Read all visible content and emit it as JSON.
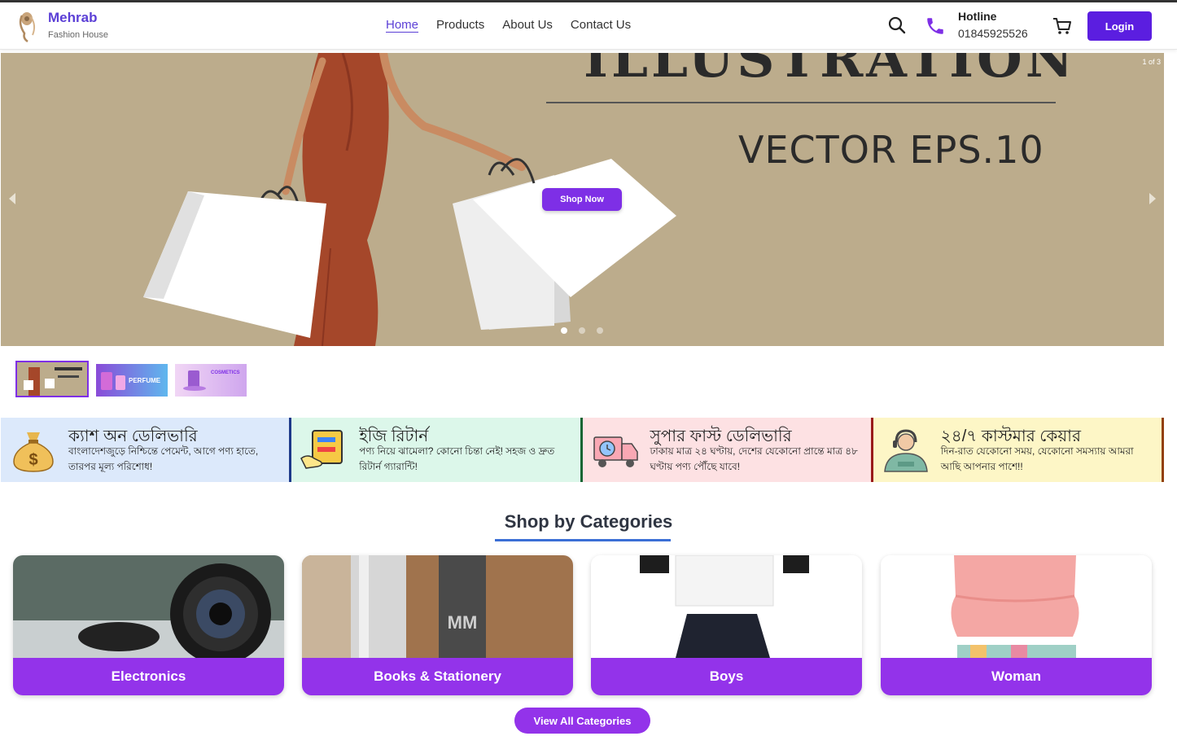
{
  "header": {
    "brand_name": "Mehrab",
    "brand_sub": "Fashion House",
    "nav": [
      {
        "label": "Home",
        "active": true
      },
      {
        "label": "Products"
      },
      {
        "label": "About Us"
      },
      {
        "label": "Contact Us"
      }
    ],
    "hotline_label": "Hotline",
    "hotline_number": "01845925526",
    "login_label": "Login",
    "icons": [
      "search-icon",
      "phone-icon",
      "cart-icon"
    ]
  },
  "hero": {
    "title": "ILLUSTRATION",
    "subtitle": "VECTOR EPS.10",
    "counter": "1 of 3",
    "cta_label": "Shop Now",
    "active_slide": 1,
    "slide_count": 3
  },
  "thumbnails": [
    {
      "label": "ILLUSTRATION",
      "active": true
    },
    {
      "label": "PERFUME"
    },
    {
      "label": "COSMETICS"
    }
  ],
  "features": [
    {
      "title": "ক্যাশ অন ডেলিভারি",
      "desc": "বাংলাদেশজুড়ে নিশ্চিন্তে পেমেন্ট, আগে পণ্য হাতে, তারপর মূল্য পরিশোধ!",
      "icon": "money-bag-icon",
      "bg": "#dce9fb",
      "border": "#1e3a8a"
    },
    {
      "title": "ইজি রিটার্ন",
      "desc": "পণ্য নিয়ে ঝামেলা? কোনো চিন্তা নেই! সহজ ও দ্রুত রিটার্ন গ্যারান্টি!",
      "icon": "return-box-icon",
      "bg": "#dcf7ea",
      "border": "#166534"
    },
    {
      "title": "সুপার ফাস্ট ডেলিভারি",
      "desc": "ঢাকায় মাত্র ২৪ ঘণ্টায়, দেশের যেকোনো প্রান্তে মাত্র ৪৮ ঘণ্টায় পণ্য পৌঁছে যাবে!",
      "icon": "delivery-truck-icon",
      "bg": "#fde1e3",
      "border": "#991b1b"
    },
    {
      "title": "২৪/৭ কাস্টমার কেয়ার",
      "desc": "দিন-রাত যেকোনো সময়, যেকোনো সমস্যায় আমরা আছি আপনার পাশে!!",
      "icon": "support-agent-icon",
      "bg": "#fdf6c6",
      "border": "#92400e"
    }
  ],
  "categories_section": {
    "title": "Shop by Categories",
    "items": [
      {
        "label": "Electronics"
      },
      {
        "label": "Books & Stationery"
      },
      {
        "label": "Boys"
      },
      {
        "label": "Woman"
      }
    ],
    "view_all_label": "View All Categories"
  },
  "colors": {
    "brand": "#5b3fd6",
    "login_button": "#5b1ee0",
    "category_label": "#9333ea",
    "hero_bg": "#bcac8c",
    "underline": "#3b6fd6"
  }
}
